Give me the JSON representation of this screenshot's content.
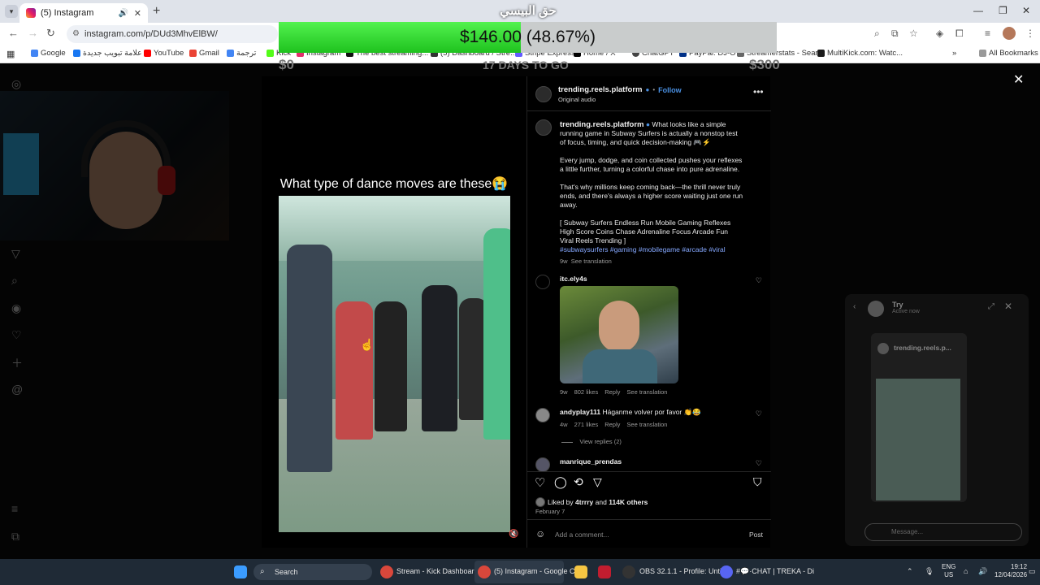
{
  "browser": {
    "tab_title": "(5) Instagram",
    "url": "instagram.com/p/DUd3MhvElBW/",
    "bookmarks": [
      "Google",
      "علامة تبويب جديدة",
      "YouTube",
      "Gmail",
      "ترجمة",
      "Kick",
      "Instagram",
      "The best streaming...",
      "(5) Dashboard / Stre...",
      "Stripe Express",
      "Home / X",
      "ChatGPT",
      "PayPal: DJ-O",
      "Streamerstats - Sear...",
      "MultiKick.com: Watc..."
    ],
    "all_bookmarks": "All Bookmarks"
  },
  "overlay": {
    "arabic_title": "حق البيسي",
    "donation_amount": "$146.00",
    "donation_percent": "(48.67%)",
    "donation_progress": 0.4867,
    "goal_start": "$0",
    "days_left": "17 DAYS TO GO",
    "goal_end": "$300"
  },
  "post": {
    "video_caption": "What type of dance moves are these😭",
    "author": "trending.reels.platform",
    "follow": "Follow",
    "audio": "Original audio",
    "caption_p1": "What looks like a simple running game in Subway Surfers is actually a nonstop test of focus, timing, and quick decision-making 🎮⚡",
    "caption_p2": "Every jump, dodge, and coin collected pushes your reflexes a little further, turning a colorful chase into pure adrenaline.",
    "caption_p3": "That's why millions keep coming back—the thrill never truly ends, and there's always a higher score waiting just one run away.",
    "caption_p4": "[ Subway Surfers Endless Run Mobile Gaming Reflexes High Score Coins Chase Adrenaline Focus Arcade Fun Viral Reels Trending ]",
    "hashtags": "#subwaysurfers #gaming #mobilegame #arcade #viral",
    "caption_age": "9w",
    "see_translation": "See translation",
    "comments": [
      {
        "user": "itc.ely4s",
        "age": "9w",
        "likes": "802 likes",
        "reply": "Reply",
        "translate": "See translation"
      },
      {
        "user": "andyplay111",
        "text": "Háganme volver por favor 👏😂",
        "age": "4w",
        "likes": "271 likes",
        "reply": "Reply",
        "translate": "See translation",
        "view_replies": "View replies (2)"
      },
      {
        "user": "manrique_prendas"
      }
    ],
    "liked_by_prefix": "Liked by",
    "liked_by_user": "4trrry",
    "liked_by_and": "and",
    "liked_by_others": "114K others",
    "date": "February 7",
    "add_comment": "Add a comment...",
    "post_btn": "Post"
  },
  "messages": {
    "name": "Try",
    "status": "Active now",
    "shared_user": "trending.reels.p...",
    "message_placeholder": "Message..."
  },
  "taskbar": {
    "search": "Search",
    "apps": [
      "Stream - Kick Dashboar",
      "(5) Instagram - Google C",
      "OBS 32.1.1 - Profile: Unti",
      "#💬·CHAT | TREKA - Di"
    ],
    "lang": "ENG",
    "region": "US",
    "time": "19:12",
    "date": "12/04/2026"
  }
}
